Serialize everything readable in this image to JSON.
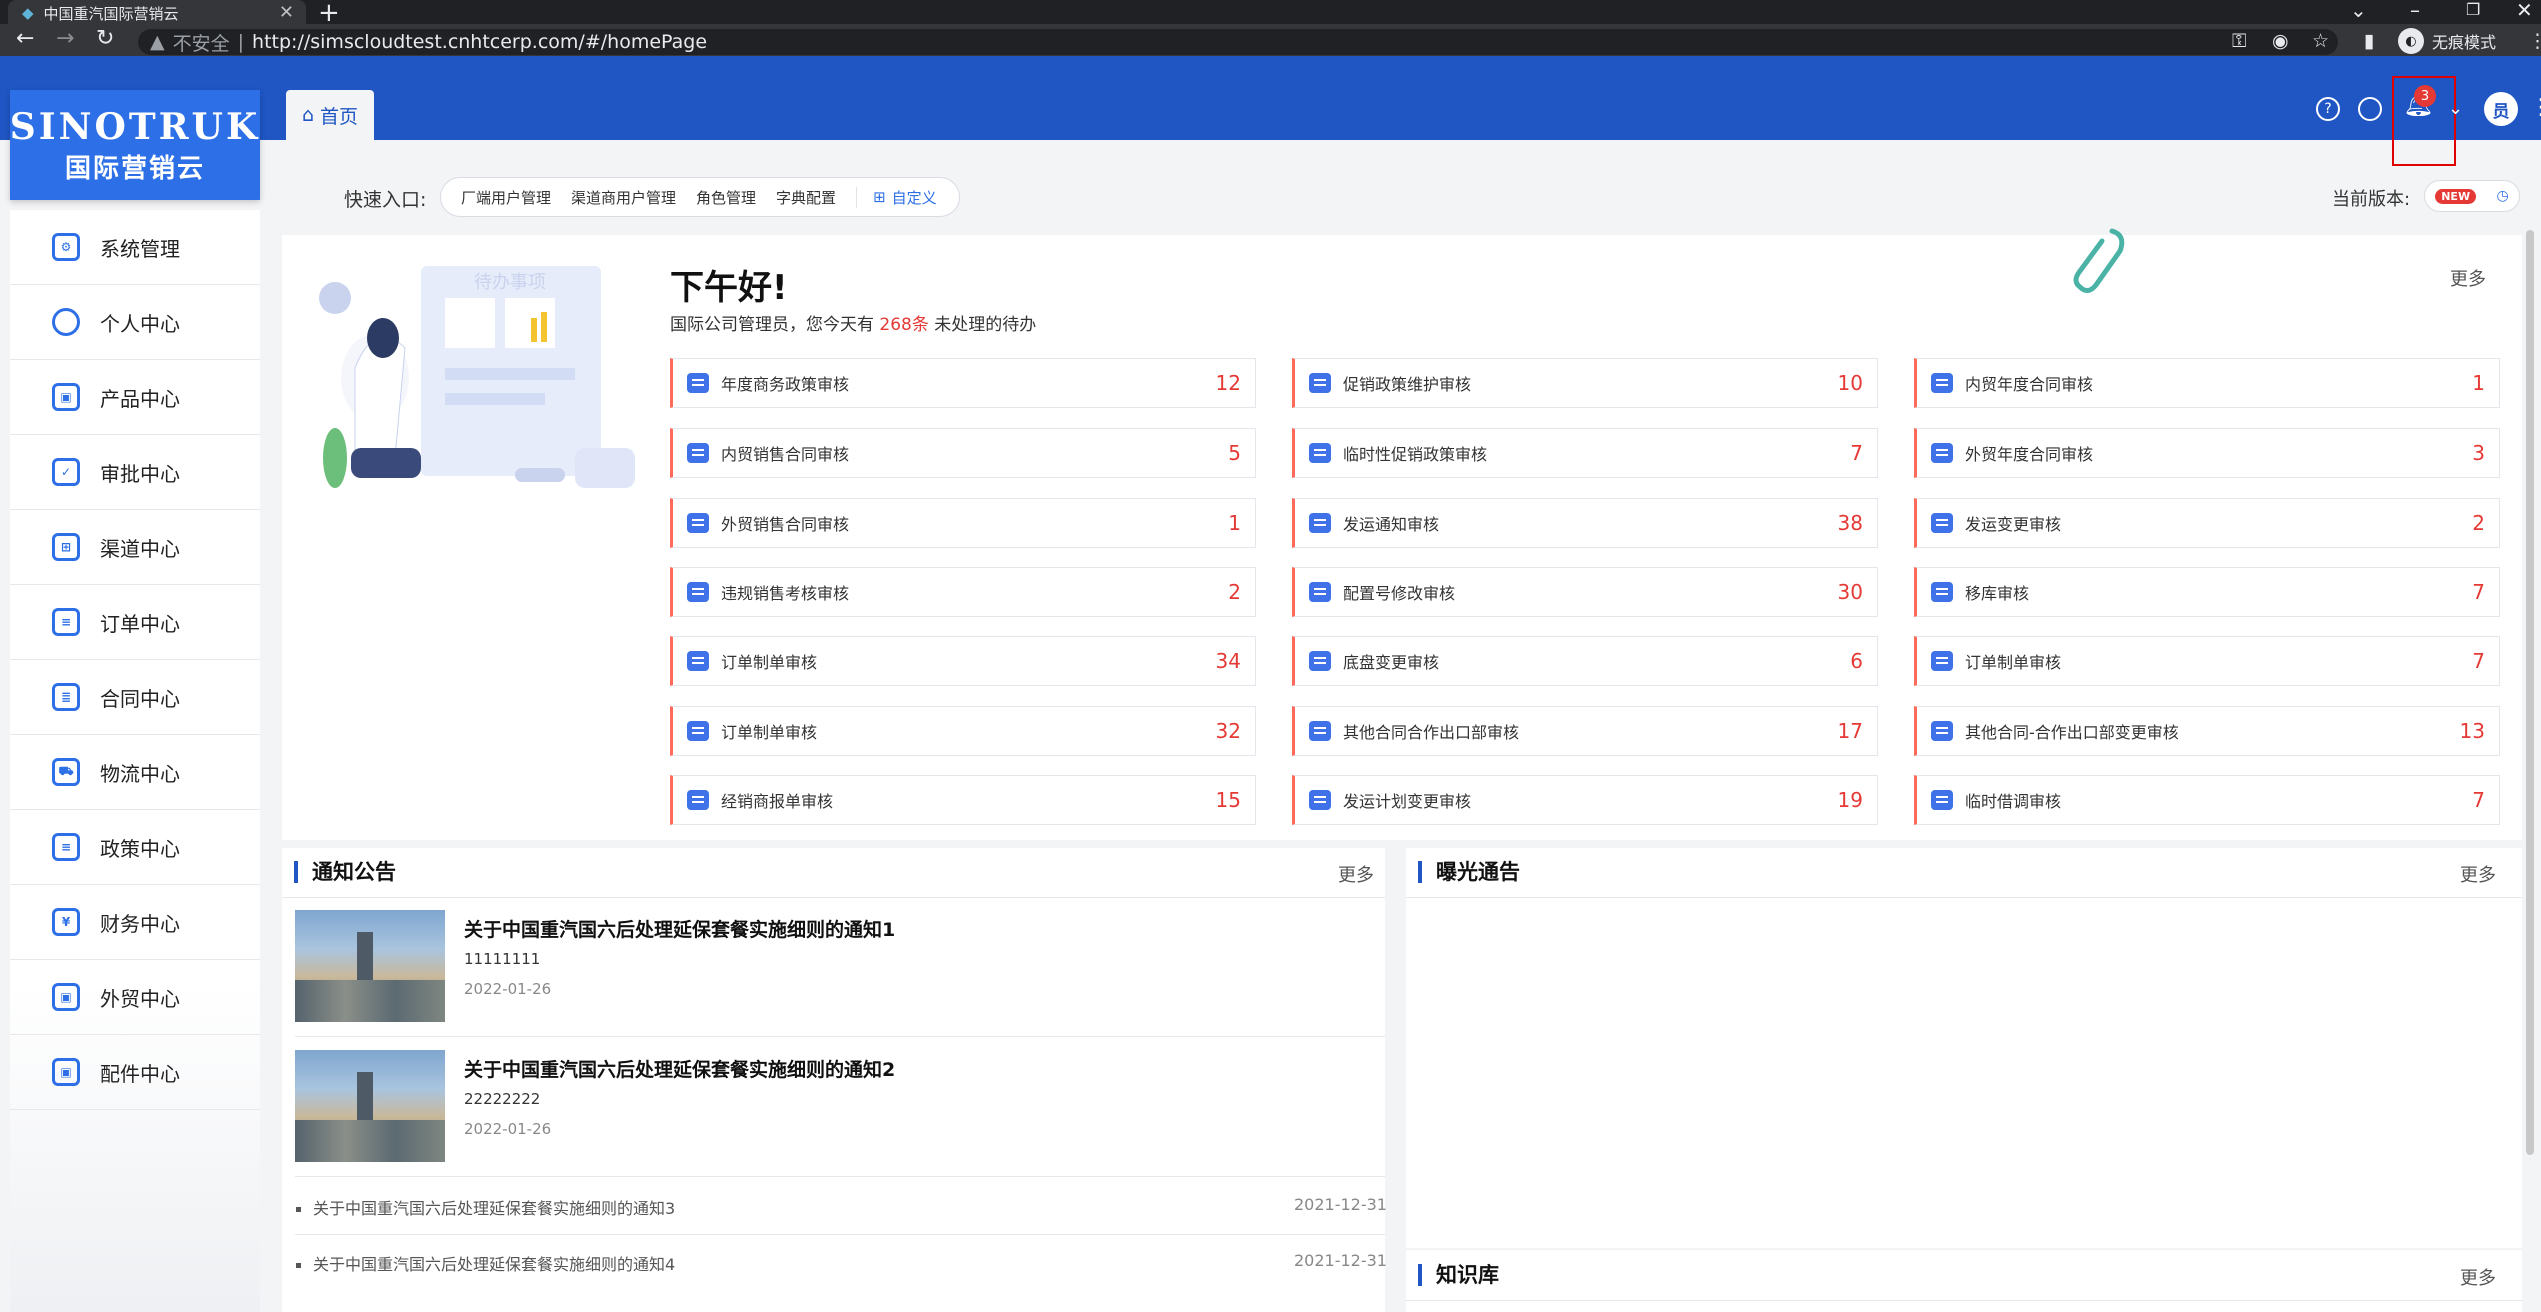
{
  "browser": {
    "tab_title": "中国重汽国际营销云",
    "security_label": "不安全",
    "url": "http://simscloudtest.cnhtcerp.com/#/homePage",
    "incognito_label": "无痕模式"
  },
  "header": {
    "logo_en": "SINOTRUK",
    "logo_cn": "国际营销云",
    "home_tab": "首页",
    "notification_count": "3",
    "user_avatar": "员"
  },
  "sidebar": {
    "items": [
      {
        "label": "系统管理",
        "icon": "gear-icon"
      },
      {
        "label": "个人中心",
        "icon": "user-icon"
      },
      {
        "label": "产品中心",
        "icon": "cubes-icon"
      },
      {
        "label": "审批中心",
        "icon": "approval-icon"
      },
      {
        "label": "渠道中心",
        "icon": "network-icon"
      },
      {
        "label": "订单中心",
        "icon": "order-icon"
      },
      {
        "label": "合同中心",
        "icon": "contract-icon"
      },
      {
        "label": "物流中心",
        "icon": "truck-icon"
      },
      {
        "label": "政策中心",
        "icon": "policy-icon"
      },
      {
        "label": "财务中心",
        "icon": "finance-icon"
      },
      {
        "label": "外贸中心",
        "icon": "cubes-icon"
      },
      {
        "label": "配件中心",
        "icon": "cubes-icon"
      }
    ]
  },
  "quick": {
    "label": "快速入口:",
    "links": [
      "厂端用户管理",
      "渠道商用户管理",
      "角色管理",
      "字典配置"
    ],
    "customize": "自定义",
    "version_label": "当前版本:",
    "new_badge": "NEW"
  },
  "todo": {
    "illustration_label": "待办事项",
    "greeting": "下午好!",
    "sub_prefix": "国际公司管理员，您今天有",
    "sub_count": "268条",
    "sub_suffix": "未处理的待办",
    "more": "更多",
    "items": [
      {
        "label": "年度商务政策审核",
        "count": "12"
      },
      {
        "label": "促销政策维护审核",
        "count": "10"
      },
      {
        "label": "内贸年度合同审核",
        "count": "1"
      },
      {
        "label": "内贸销售合同审核",
        "count": "5"
      },
      {
        "label": "临时性促销政策审核",
        "count": "7"
      },
      {
        "label": "外贸年度合同审核",
        "count": "3"
      },
      {
        "label": "外贸销售合同审核",
        "count": "1"
      },
      {
        "label": "发运通知审核",
        "count": "38"
      },
      {
        "label": "发运变更审核",
        "count": "2"
      },
      {
        "label": "违规销售考核审核",
        "count": "2"
      },
      {
        "label": "配置号修改审核",
        "count": "30"
      },
      {
        "label": "移库审核",
        "count": "7"
      },
      {
        "label": "订单制单审核",
        "count": "34"
      },
      {
        "label": "底盘变更审核",
        "count": "6"
      },
      {
        "label": "订单制单审核",
        "count": "7"
      },
      {
        "label": "订单制单审核",
        "count": "32"
      },
      {
        "label": "其他合同合作出口部审核",
        "count": "17"
      },
      {
        "label": "其他合同-合作出口部变更审核",
        "count": "13"
      },
      {
        "label": "经销商报单审核",
        "count": "15"
      },
      {
        "label": "发运计划变更审核",
        "count": "19"
      },
      {
        "label": "临时借调审核",
        "count": "7"
      }
    ]
  },
  "notice": {
    "title": "通知公告",
    "more": "更多",
    "featured": [
      {
        "title": "关于中国重汽国六后处理延保套餐实施细则的通知1",
        "sub": "11111111",
        "date": "2022-01-26"
      },
      {
        "title": "关于中国重汽国六后处理延保套餐实施细则的通知2",
        "sub": "22222222",
        "date": "2022-01-26"
      }
    ],
    "list": [
      {
        "title": "关于中国重汽国六后处理延保套餐实施细则的通知3",
        "date": "2021-12-31"
      },
      {
        "title": "关于中国重汽国六后处理延保套餐实施细则的通知4",
        "date": "2021-12-31"
      }
    ]
  },
  "exposure": {
    "title": "曝光通告",
    "more": "更多"
  },
  "knowledge": {
    "title": "知识库",
    "more": "更多"
  }
}
